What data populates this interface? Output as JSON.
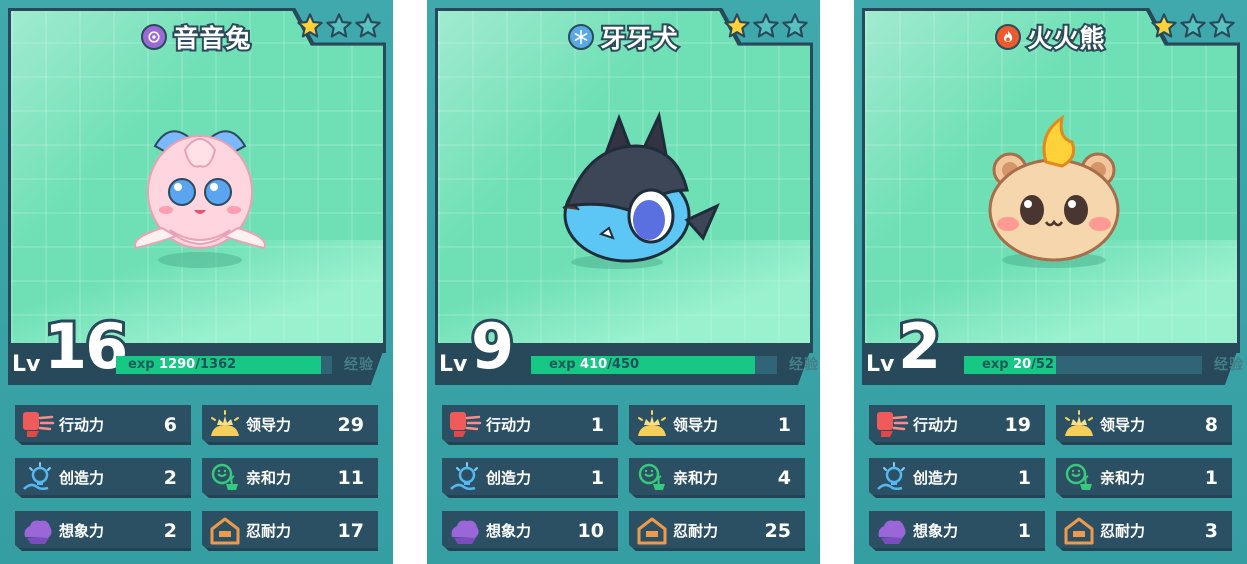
{
  "cards": [
    {
      "name": "音音兔",
      "type_icon": "sound-icon",
      "type_color": "#9a6bd6",
      "stars_filled": 1,
      "stars_total": 3,
      "level_label": "Lv",
      "level": "16",
      "exp_prefix": "exp",
      "exp_current": "1290",
      "exp_max": "/1362",
      "exp_fraction": 0.947,
      "exp_label": "经验",
      "stats": [
        {
          "icon": "action-icon",
          "label": "行动力",
          "value": "6"
        },
        {
          "icon": "leadership-icon",
          "label": "领导力",
          "value": "29"
        },
        {
          "icon": "creativity-icon",
          "label": "创造力",
          "value": "2"
        },
        {
          "icon": "affinity-icon",
          "label": "亲和力",
          "value": "11"
        },
        {
          "icon": "imagination-icon",
          "label": "想象力",
          "value": "2"
        },
        {
          "icon": "endurance-icon",
          "label": "忍耐力",
          "value": "17"
        }
      ]
    },
    {
      "name": "牙牙犬",
      "type_icon": "snowflake-icon",
      "type_color": "#5aa7e6",
      "stars_filled": 1,
      "stars_total": 3,
      "level_label": "Lv",
      "level": "9",
      "exp_prefix": "exp",
      "exp_current": "410",
      "exp_max": "/450",
      "exp_fraction": 0.911,
      "exp_label": "经验",
      "stats": [
        {
          "icon": "action-icon",
          "label": "行动力",
          "value": "1"
        },
        {
          "icon": "leadership-icon",
          "label": "领导力",
          "value": "1"
        },
        {
          "icon": "creativity-icon",
          "label": "创造力",
          "value": "1"
        },
        {
          "icon": "affinity-icon",
          "label": "亲和力",
          "value": "4"
        },
        {
          "icon": "imagination-icon",
          "label": "想象力",
          "value": "10"
        },
        {
          "icon": "endurance-icon",
          "label": "忍耐力",
          "value": "25"
        }
      ]
    },
    {
      "name": "火火熊",
      "type_icon": "fire-icon",
      "type_color": "#ec5a2e",
      "stars_filled": 1,
      "stars_total": 3,
      "level_label": "Lv",
      "level": "2",
      "exp_prefix": "exp",
      "exp_current": "20",
      "exp_max": "/52",
      "exp_fraction": 0.385,
      "exp_label": "经验",
      "stats": [
        {
          "icon": "action-icon",
          "label": "行动力",
          "value": "19"
        },
        {
          "icon": "leadership-icon",
          "label": "领导力",
          "value": "8"
        },
        {
          "icon": "creativity-icon",
          "label": "创造力",
          "value": "1"
        },
        {
          "icon": "affinity-icon",
          "label": "亲和力",
          "value": "1"
        },
        {
          "icon": "imagination-icon",
          "label": "想象力",
          "value": "1"
        },
        {
          "icon": "endurance-icon",
          "label": "忍耐力",
          "value": "3"
        }
      ]
    }
  ]
}
